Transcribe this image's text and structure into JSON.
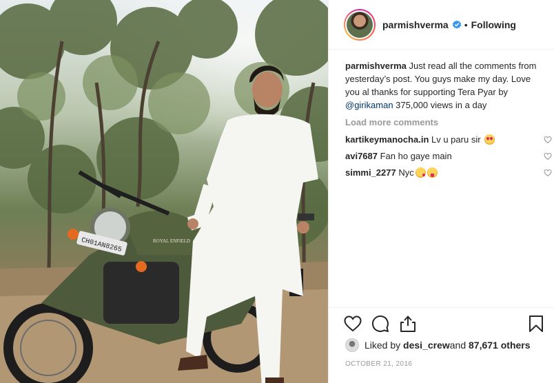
{
  "post": {
    "username": "parmishverma",
    "follow_status": "Following",
    "separator": "•"
  },
  "caption": {
    "username": "parmishverma",
    "text_before_mention": " Just read all the comments from yesterday’s post. You guys make my day. Love you al thanks for supporting Tera Pyar by ",
    "mention": "@girikaman",
    "text_after_mention": " 375,000 views in a day"
  },
  "load_more_label": "Load more comments",
  "comments": [
    {
      "username": "kartikeymanocha.in",
      "text": " Lv u paru sir "
    },
    {
      "username": "avi7687",
      "text": " Fan ho gaye main"
    },
    {
      "username": "simmi_2277",
      "text": " Nyc"
    }
  ],
  "likes": {
    "prefix": "Liked by ",
    "user": "desi_crew",
    "suffix": " and ",
    "others": "87,671 others"
  },
  "date": "OCTOBER 21, 2016",
  "photo": {
    "plate_text": "CH01AN8265",
    "tank_text": "ROYAL ENFIELD"
  },
  "icons": {
    "verified": "verified-badge-icon",
    "like": "heart-icon",
    "comment": "comment-bubble-icon",
    "share": "share-icon",
    "save": "bookmark-icon"
  },
  "colors": {
    "link": "#003569",
    "verified": "#3897f0",
    "muted": "#999999",
    "text": "#262626"
  }
}
